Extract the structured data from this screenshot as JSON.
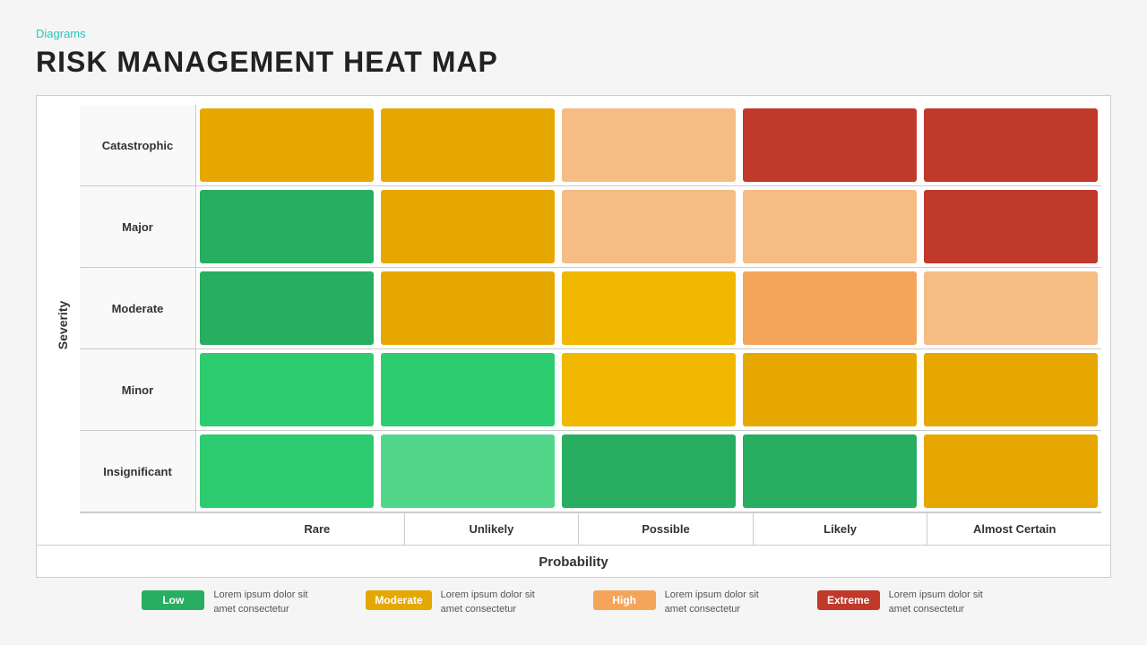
{
  "breadcrumb": "Diagrams",
  "title": "RISK MANAGEMENT HEAT MAP",
  "severity_label": "Severity",
  "probability_label": "Probability",
  "rows": [
    {
      "label": "Catastrophic",
      "cells": [
        {
          "color": "c-yellow-dark"
        },
        {
          "color": "c-yellow-dark"
        },
        {
          "color": "c-orange-light"
        },
        {
          "color": "c-red-dark"
        },
        {
          "color": "c-red-dark"
        }
      ]
    },
    {
      "label": "Major",
      "cells": [
        {
          "color": "c-green-dark"
        },
        {
          "color": "c-yellow-dark"
        },
        {
          "color": "c-orange-light"
        },
        {
          "color": "c-orange-light"
        },
        {
          "color": "c-red-dark"
        }
      ]
    },
    {
      "label": "Moderate",
      "cells": [
        {
          "color": "c-green-dark"
        },
        {
          "color": "c-yellow-dark"
        },
        {
          "color": "c-yellow-med"
        },
        {
          "color": "c-orange-med"
        },
        {
          "color": "c-orange-light"
        }
      ]
    },
    {
      "label": "Minor",
      "cells": [
        {
          "color": "c-green-med"
        },
        {
          "color": "c-green-med"
        },
        {
          "color": "c-yellow-med"
        },
        {
          "color": "c-yellow-dark"
        },
        {
          "color": "c-yellow-dark"
        }
      ]
    },
    {
      "label": "Insignificant",
      "cells": [
        {
          "color": "c-green-med"
        },
        {
          "color": "c-green-light"
        },
        {
          "color": "c-green-dark"
        },
        {
          "color": "c-green-dark"
        },
        {
          "color": "c-yellow-dark"
        }
      ]
    }
  ],
  "col_headers": [
    "Rare",
    "Unlikely",
    "Possible",
    "Likely",
    "Almost Certain"
  ],
  "legend": [
    {
      "badge_label": "Low",
      "badge_color": "#27ae60",
      "description": "Lorem ipsum dolor sit amet consectetur"
    },
    {
      "badge_label": "Moderate",
      "badge_color": "#e6a800",
      "description": "Lorem ipsum dolor sit amet consectetur"
    },
    {
      "badge_label": "High",
      "badge_color": "#f5a55a",
      "description": "Lorem ipsum dolor sit amet consectetur"
    },
    {
      "badge_label": "Extreme",
      "badge_color": "#c0392b",
      "description": "Lorem ipsum dolor sit amet consectetur"
    }
  ]
}
